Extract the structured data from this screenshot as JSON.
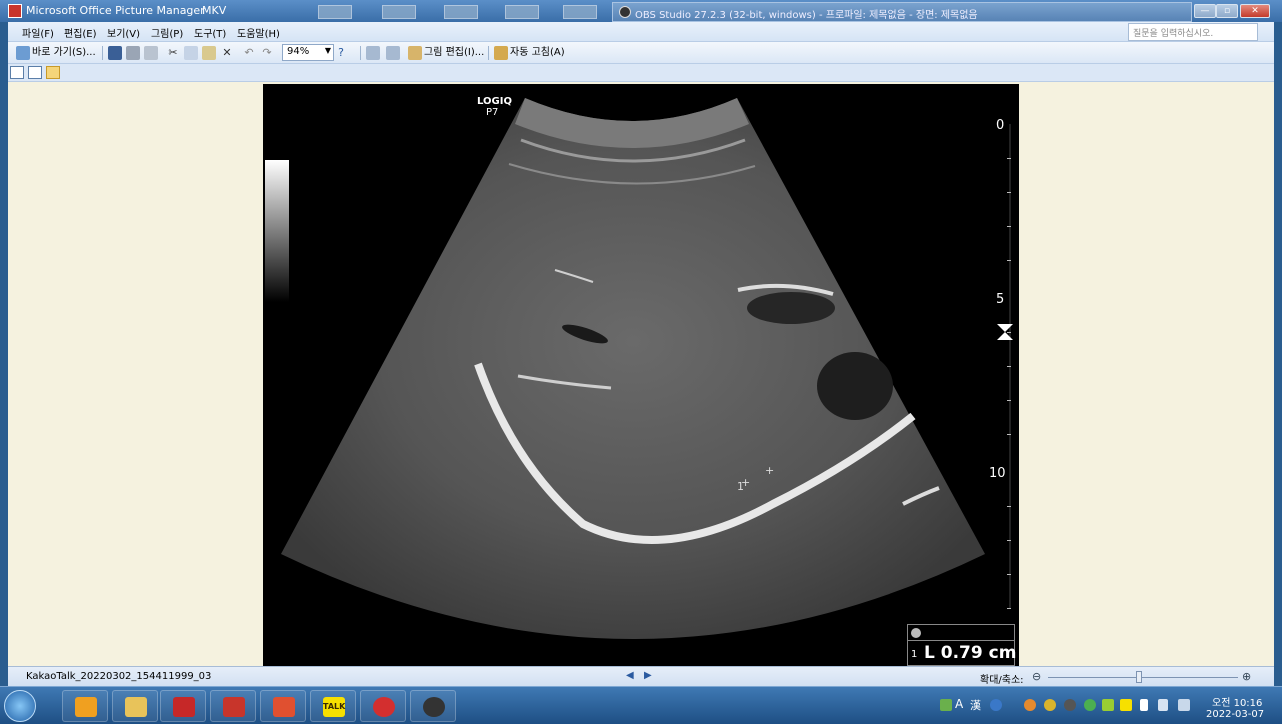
{
  "titlebar": {
    "title": "Microsoft Office Picture Manager",
    "secondary_title": "MKV",
    "obs_title": "OBS Studio 27.2.3 (32-bit, windows) - 프로파일: 제목없음 - 장면: 제목없음",
    "minimize": "—",
    "maximize": "▫",
    "close": "✕"
  },
  "menubar": {
    "items": [
      "파일(F)",
      "편집(E)",
      "보기(V)",
      "그림(P)",
      "도구(T)",
      "도움말(H)"
    ],
    "help_placeholder": "질문을 입력하십시오."
  },
  "toolbar": {
    "goto_label": "바로 가기(S)...",
    "zoom_value": "94%",
    "edit_picture_label": "그림 편집(I)...",
    "auto_correct_label": "자동 고침(A)"
  },
  "image": {
    "logo_line1": "LOGIQ",
    "logo_line2": "P7",
    "depth_marks": [
      "0",
      "5",
      "10"
    ],
    "measurement_index": "1",
    "measurement_value": "L 0.79 cm",
    "caliper_label": "1"
  },
  "statusbar": {
    "filename": "KakaoTalk_20220302_154411999_03",
    "prev": "◀",
    "next": "▶",
    "zoom_label": "확대/축소:"
  },
  "taskbar": {
    "talk_label": "TALK",
    "lang_a": "A",
    "lang_han": "漢",
    "time": "오전 10:16",
    "date": "2022-03-07"
  }
}
